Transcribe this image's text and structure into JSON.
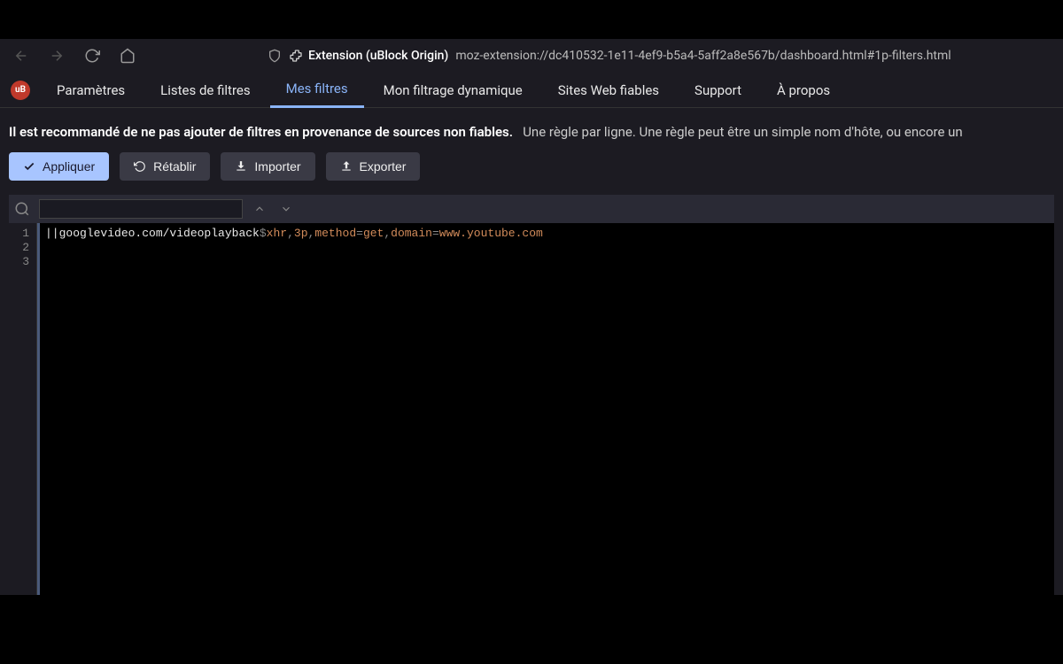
{
  "browser": {
    "extension_label": "Extension (uBlock Origin)",
    "url": "moz-extension://dc410532-1e11-4ef9-b5a4-5aff2a8e567b/dashboard.html#1p-filters.html"
  },
  "ext_icon_label": "uB",
  "tabs": [
    "Paramètres",
    "Listes de filtres",
    "Mes filtres",
    "Mon filtrage dynamique",
    "Sites Web fiables",
    "Support",
    "À propos"
  ],
  "active_tab_index": 2,
  "notice": {
    "bold": "Il est recommandé de ne pas ajouter de filtres en provenance de sources non fiables.",
    "rest": "Une règle par ligne. Une règle peut être un simple nom d'hôte, ou encore un"
  },
  "buttons": {
    "apply": "Appliquer",
    "revert": "Rétablir",
    "import": "Importer",
    "export": "Exporter"
  },
  "search": {
    "value": ""
  },
  "editor": {
    "line_numbers": [
      "1",
      "2",
      "3"
    ],
    "rule": {
      "prefix": "||",
      "url": "googlevideo.com/videoplayback",
      "sep": "$",
      "opt1": "xhr",
      "comma1": ",",
      "opt2": "3p",
      "comma2": ",",
      "key1": "method",
      "eq1": "=",
      "val1": "get",
      "comma3": ",",
      "key2": "domain",
      "eq2": "=",
      "val2": "www.youtube.com"
    }
  }
}
